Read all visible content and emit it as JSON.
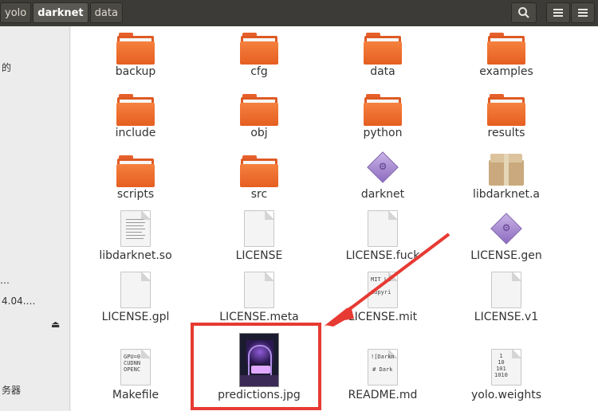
{
  "breadcrumb": [
    "yolo",
    "darknet",
    "data"
  ],
  "sidebar": {
    "fragments": [
      "的",
      "…",
      "4.04.…",
      "务器"
    ]
  },
  "files": [
    {
      "name": "backup",
      "type": "folder"
    },
    {
      "name": "cfg",
      "type": "folder"
    },
    {
      "name": "data",
      "type": "folder"
    },
    {
      "name": "examples",
      "type": "folder"
    },
    {
      "name": "include",
      "type": "folder"
    },
    {
      "name": "obj",
      "type": "folder"
    },
    {
      "name": "python",
      "type": "folder"
    },
    {
      "name": "results",
      "type": "folder"
    },
    {
      "name": "scripts",
      "type": "folder"
    },
    {
      "name": "src",
      "type": "folder"
    },
    {
      "name": "darknet",
      "type": "executable"
    },
    {
      "name": "libdarknet.a",
      "type": "archive"
    },
    {
      "name": "libdarknet.so",
      "type": "text-lines"
    },
    {
      "name": "LICENSE",
      "type": "document"
    },
    {
      "name": "LICENSE.fuck",
      "type": "document"
    },
    {
      "name": "LICENSE.gen",
      "type": "executable"
    },
    {
      "name": "LICENSE.gpl",
      "type": "document"
    },
    {
      "name": "LICENSE.meta",
      "type": "document"
    },
    {
      "name": "LICENSE.mit",
      "type": "document",
      "preview": "MIT Li\n\nCopyri"
    },
    {
      "name": "LICENSE.v1",
      "type": "document"
    },
    {
      "name": "Makefile",
      "type": "document",
      "preview": "GPU=0\nCUDNN\nOPENC"
    },
    {
      "name": "predictions.jpg",
      "type": "image"
    },
    {
      "name": "README.md",
      "type": "document",
      "preview": "![Darkn\n\n# Dark"
    },
    {
      "name": "yolo.weights",
      "type": "document",
      "preview": "1\n10\n101\n1010"
    }
  ],
  "colors": {
    "folder": "#e55e22",
    "highlight": "#e63a32",
    "header": "#3c3b37"
  }
}
